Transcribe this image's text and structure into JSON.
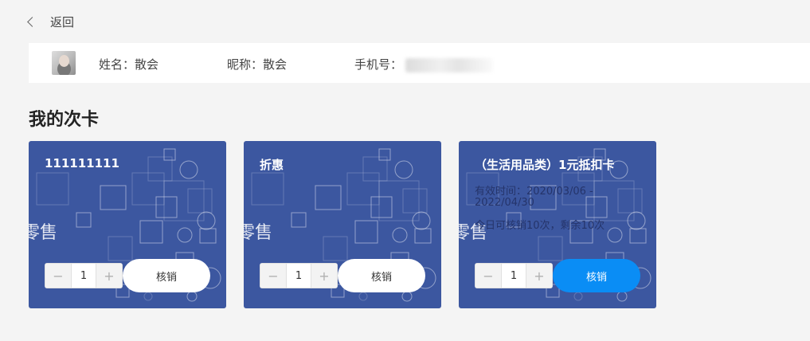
{
  "header": {
    "back_label": "返回"
  },
  "user": {
    "name_label": "姓名：散会",
    "nickname_label": "昵称：散会",
    "phone_label": "手机号："
  },
  "section": {
    "title": "我的次卡"
  },
  "watermark": "零售",
  "cards": [
    {
      "title": "111111111",
      "quantity": "1",
      "action": "核销",
      "validity": "",
      "usage": ""
    },
    {
      "title": "折惠",
      "quantity": "1",
      "action": "核销",
      "validity": "",
      "usage": ""
    },
    {
      "title": "（生活用品类）1元抵扣卡",
      "quantity": "1",
      "action": "核销",
      "validity": "有效时间：2020/03/06 - 2022/04/30",
      "usage": "今日可核销10次，剩余10次"
    }
  ],
  "stepper": {
    "minus": "−",
    "plus": "+"
  },
  "colors": {
    "card_bg": "#3c57a0",
    "active_button": "#0a8df5",
    "page_bg": "#f4f4f4"
  }
}
